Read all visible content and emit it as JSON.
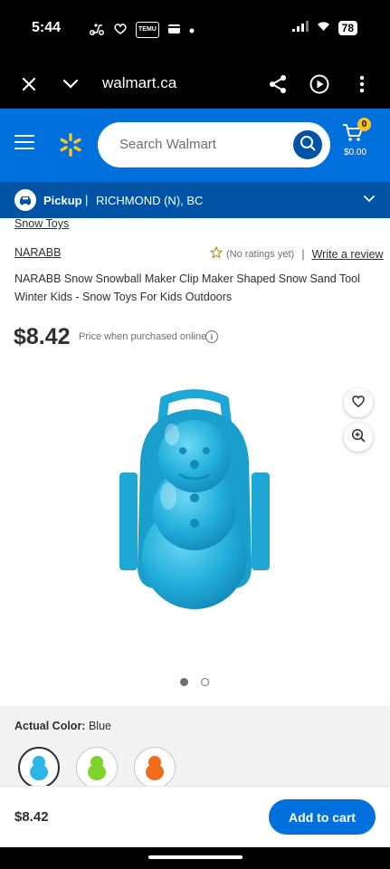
{
  "status_bar": {
    "time": "5:44",
    "icons_left": [
      "scooter-icon",
      "heart-hand-icon",
      "temu-icon",
      "wallet-icon",
      "dot-icon"
    ],
    "temu_text": "TEMU",
    "battery": "78"
  },
  "browser": {
    "url": "walmart.ca"
  },
  "header": {
    "search_placeholder": "Search Walmart",
    "cart_count": "0",
    "cart_total": "$0.00",
    "brand_color": "#0071dc",
    "spark_color": "#ffc220"
  },
  "pickup": {
    "label": "Pickup",
    "separator": "|",
    "location": "RICHMOND (N), BC"
  },
  "product": {
    "breadcrumb": "Snow Toys",
    "brand": "NARABB",
    "rating_text": "(No ratings yet)",
    "rating_separator": "|",
    "write_review": "Write a review",
    "title": "NARABB Snow Snowball Maker Clip Maker Shaped Snow Sand Tool Winter Kids - Snow Toys For Kids Outdoors",
    "price": "$8.42",
    "price_note": "Price when purchased online",
    "info_glyph": "i",
    "image_count": 2,
    "active_image": 1
  },
  "color_selector": {
    "label": "Actual Color:",
    "value": "Blue",
    "swatches": [
      {
        "name": "Blue",
        "color": "#2ab6e6",
        "selected": true
      },
      {
        "name": "Green",
        "color": "#7fd32a",
        "selected": false
      },
      {
        "name": "Orange",
        "color": "#f26d1b",
        "selected": false
      }
    ]
  },
  "bottom_bar": {
    "price": "$8.42",
    "add_to_cart": "Add to cart"
  }
}
